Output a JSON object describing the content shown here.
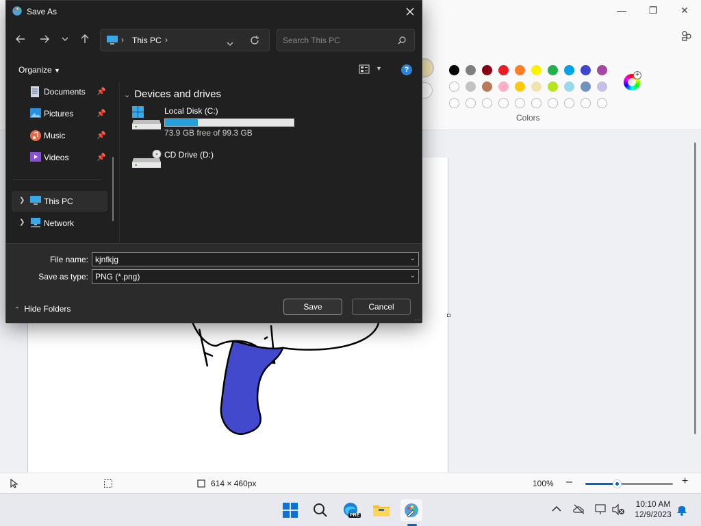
{
  "dialog": {
    "title": "Save As",
    "address": {
      "location": "This PC"
    },
    "search": {
      "placeholder": "Search This PC"
    },
    "organize_label": "Organize",
    "nav_items": [
      {
        "label": "Documents",
        "pinned": true
      },
      {
        "label": "Pictures",
        "pinned": true
      },
      {
        "label": "Music",
        "pinned": true
      },
      {
        "label": "Videos",
        "pinned": true
      },
      {
        "label": "This PC",
        "selected": true
      },
      {
        "label": "Network"
      }
    ],
    "group_header": "Devices and drives",
    "drives": [
      {
        "name": "Local Disk (C:)",
        "free_text": "73.9 GB free of 99.3 GB",
        "used_fraction": 0.256
      },
      {
        "name": "CD Drive (D:)"
      }
    ],
    "file_name_label": "File name:",
    "file_name_value": "kjnfkjg",
    "save_type_label": "Save as type:",
    "save_type_value": "PNG (*.png)",
    "hide_folders_label": "Hide Folders",
    "save_label": "Save",
    "cancel_label": "Cancel"
  },
  "paint": {
    "colors_label": "Colors",
    "palette_row1": [
      "#000000",
      "#7f7f7f",
      "#880015",
      "#ed1c24",
      "#ff7f27",
      "#fff200",
      "#22b14c",
      "#00a2e8",
      "#3f48cc",
      "#a349a4"
    ],
    "palette_row2": [
      "#ffffff",
      "#c3c3c3",
      "#b97a57",
      "#ffaec9",
      "#ffc90e",
      "#efe4b0",
      "#b5e61d",
      "#99d9ea",
      "#7092be",
      "#c8bfe7"
    ],
    "fill_color": "#4249cc",
    "status": {
      "canvas_size": "614 × 460px",
      "zoom": "100%",
      "zoom_fraction": 0.36
    }
  },
  "taskbar": {
    "time": "10:10 AM",
    "date": "12/9/2023",
    "edge_badge": "PRE"
  }
}
